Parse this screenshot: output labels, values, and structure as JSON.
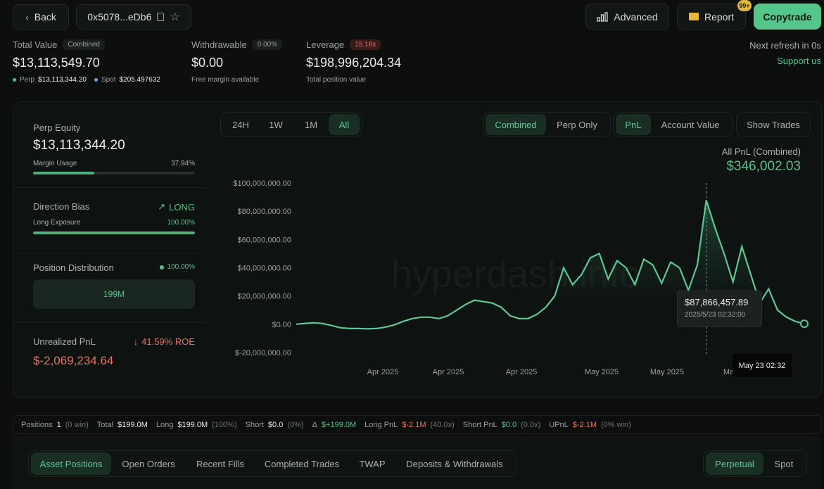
{
  "header": {
    "back_label": "Back",
    "address": "0x5078...eDb6",
    "advanced_label": "Advanced",
    "report_label": "Report",
    "report_badge": "99+",
    "copytrade_label": "Copytrade"
  },
  "summary": {
    "total_value_label": "Total Value",
    "total_value_tag": "Combined",
    "total_value": "$13,113,549.70",
    "perp_label": "Perp",
    "perp_value": "$13,113,344.20",
    "spot_label": "Spot",
    "spot_value": "$205.497632",
    "withdrawable_label": "Withdrawable",
    "withdrawable_tag": "0.00%",
    "withdrawable_value": "$0.00",
    "withdrawable_sub": "Free margin available",
    "leverage_label": "Leverage",
    "leverage_tag": "15.18x",
    "leverage_value": "$198,996,204.34",
    "leverage_sub": "Total position value",
    "refresh_text": "Next refresh in 0s",
    "support_text": "Support us"
  },
  "left_panel": {
    "perp_equity_label": "Perp Equity",
    "perp_equity_value": "$13,113,344.20",
    "margin_usage_label": "Margin Usage",
    "margin_usage_value": "37.94%",
    "margin_usage_fraction": 0.3794,
    "direction_bias_label": "Direction Bias",
    "direction_bias_value": "LONG",
    "long_exposure_label": "Long Exposure",
    "long_exposure_value": "100.00%",
    "long_exposure_fraction": 1.0,
    "position_distribution_label": "Position Distribution",
    "position_distribution_value": "100.00%",
    "distribution_block": "199M",
    "unrealized_pnl_label": "Unrealized PnL",
    "roe_value": "41.59% ROE",
    "unrealized_pnl_value": "$-2,069,234.64"
  },
  "chart_controls": {
    "ranges": [
      "24H",
      "1W",
      "1M",
      "All"
    ],
    "active_range": "All",
    "modes": [
      "Combined",
      "Perp Only"
    ],
    "active_mode": "Combined",
    "metrics": [
      "PnL",
      "Account Value"
    ],
    "active_metric": "PnL",
    "show_trades_label": "Show Trades"
  },
  "chart_data": {
    "type": "area",
    "title": "All PnL (Combined)",
    "headline_value": "$346,002.03",
    "watermark": "hyperdash.info",
    "y_ticks": [
      "$100,000,000.00",
      "$80,000,000.00",
      "$60,000,000.00",
      "$40,000,000.00",
      "$20,000,000.00",
      "$0.00",
      "$-20,000,000.00"
    ],
    "ylim": [
      -20000000,
      100000000
    ],
    "x_ticks": [
      "Apr 2025",
      "Apr 2025",
      "Apr 2025",
      "May 2025",
      "May 2025",
      "May 2025"
    ],
    "series": [
      {
        "values": [
          0,
          600000,
          1000000,
          500000,
          -1000000,
          -2500000,
          -3000000,
          -3000000,
          -3200000,
          -3000000,
          -2000000,
          -500000,
          2000000,
          4000000,
          5000000,
          5000000,
          4000000,
          6000000,
          10000000,
          14000000,
          17000000,
          16000000,
          15000000,
          12000000,
          6000000,
          4000000,
          4000000,
          7000000,
          12000000,
          20000000,
          40000000,
          28000000,
          35000000,
          47000000,
          50000000,
          32000000,
          45000000,
          40000000,
          28000000,
          46000000,
          42000000,
          29000000,
          44000000,
          40000000,
          24000000,
          42000000,
          87866457,
          68000000,
          50000000,
          30000000,
          55000000,
          35000000,
          15000000,
          25000000,
          10000000,
          5000000,
          2000000,
          346002
        ]
      }
    ],
    "tooltip": {
      "value": "$87,866,457.89",
      "timestamp": "2025/5/23 02:32:00"
    },
    "crosshair_label": "May 23 02:32",
    "line_color": "#5ec792"
  },
  "stats_bar": {
    "positions_label": "Positions",
    "positions_value": "1",
    "positions_win": "(0 win)",
    "total_label": "Total",
    "total_value": "$199.0M",
    "long_label": "Long",
    "long_value": "$199.0M",
    "long_pct": "(100%)",
    "short_label": "Short",
    "short_value": "$0.0",
    "short_pct": "(0%)",
    "delta_label": "Δ",
    "delta_value": "$+199.0M",
    "long_pnl_label": "Long PnL",
    "long_pnl_value": "$-2.1M",
    "long_pnl_x": "(40.0x)",
    "short_pnl_label": "Short PnL",
    "short_pnl_value": "$0.0",
    "short_pnl_x": "(0.0x)",
    "upnl_label": "UPnL",
    "upnl_value": "$-2.1M",
    "upnl_win": "(0% win)"
  },
  "bottom_tabs": {
    "tabs": [
      "Asset Positions",
      "Open Orders",
      "Recent Fills",
      "Completed Trades",
      "TWAP",
      "Deposits & Withdrawals"
    ],
    "active_tab": "Asset Positions",
    "market_types": [
      "Perpetual",
      "Spot"
    ],
    "active_market": "Perpetual"
  }
}
